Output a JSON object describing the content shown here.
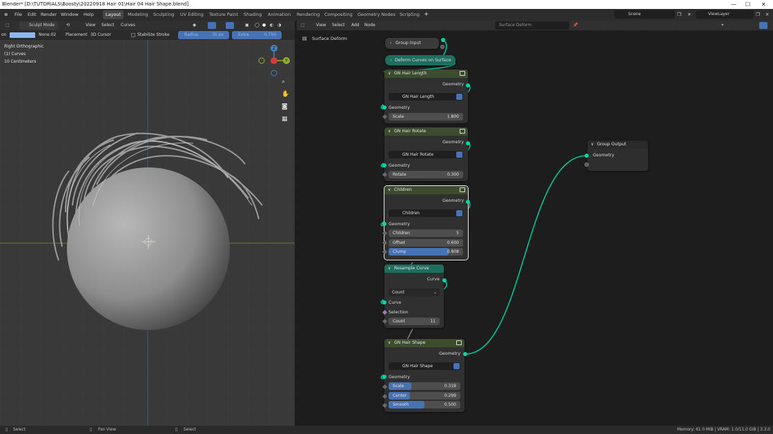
{
  "window": {
    "title": "Blender* [D:\\TUTORIALS\\Boosty\\20220918 Hair 01\\Hair 04 Hair Shape.blend]"
  },
  "menu": [
    "File",
    "Edit",
    "Render",
    "Window",
    "Help"
  ],
  "workspaces": [
    "Layout",
    "Modeling",
    "Sculpting",
    "UV Editing",
    "Texture Paint",
    "Shading",
    "Animation",
    "Rendering",
    "Compositing",
    "Geometry Nodes",
    "Scripting"
  ],
  "active_workspace": "Layout",
  "scene": {
    "label": "Scene",
    "view_layer": "ViewLayer"
  },
  "viewport": {
    "mode": "Sculpt Mode",
    "menus": [
      "View",
      "Select",
      "Curves"
    ],
    "tool": {
      "on_label": "on",
      "brush": "None.02",
      "placement_label": "Placement",
      "placement": "3D Cursor",
      "stabilize": "Stabilize Stroke",
      "radius_label": "Radius",
      "radius_value": "35 px",
      "extra_label": "Extra",
      "extra_value": "0.750"
    },
    "overlay_text": [
      "Right Orthographic",
      "(1) Curves",
      "10 Centimeters"
    ],
    "gizmo": {
      "z": "Z",
      "y": "Y"
    }
  },
  "node_editor": {
    "menus": [
      "View",
      "Select",
      "Add",
      "Node"
    ],
    "tree_name": "Surface Deform",
    "breadcrumb": "Surface Deform",
    "nodes": {
      "group_input": {
        "title": "Group Input"
      },
      "deform": {
        "title": "Deform Curves on Surface"
      },
      "hair_length": {
        "title": "GN Hair Length",
        "out": "Geometry",
        "group": "GN Hair Length",
        "in": "Geometry",
        "fields": [
          {
            "label": "Scale",
            "value": "1.800"
          }
        ]
      },
      "hair_rotate": {
        "title": "GN Hair Rotate",
        "out": "Geometry",
        "group": "GN Hair Rotate",
        "in": "Geometry",
        "fields": [
          {
            "label": "Rotate",
            "value": "0.300"
          }
        ]
      },
      "children": {
        "title": "Children",
        "out": "Geometry",
        "group": "Children",
        "in": "Geometry",
        "fields": [
          {
            "label": "Children",
            "value": "5"
          },
          {
            "label": "Offset",
            "value": "0.600"
          },
          {
            "label": "Clump",
            "value": "0.808",
            "fill": 0.808
          }
        ]
      },
      "resample": {
        "title": "Resample Curve",
        "out": "Curve",
        "mode": "Count",
        "in": "Curve",
        "selection": "Selection",
        "fields": [
          {
            "label": "Count",
            "value": "11"
          }
        ]
      },
      "hair_shape": {
        "title": "GN Hair Shape",
        "out": "Geometry",
        "group": "GN Hair Shape",
        "in": "Geometry",
        "fields": [
          {
            "label": "Scale",
            "value": "0.319",
            "fill": 0.319
          },
          {
            "label": "Center",
            "value": "0.299",
            "fill": 0.299
          },
          {
            "label": "Smooth",
            "value": "0.500",
            "fill": 0.5
          }
        ]
      },
      "group_output": {
        "title": "Group Output",
        "in": "Geometry"
      }
    }
  },
  "status": {
    "left_select": "Select",
    "pan_view": "Pan View",
    "right_select": "Select",
    "memory": "Memory: 61.0 MiB | VRAM: 1.0/11.0 GiB | 3.3.0"
  },
  "colors": {
    "geometry_socket": "#00d6a3",
    "group_header": "#3c4d2f",
    "teal_header": "#1e6e5e",
    "accent": "#4772b3"
  }
}
